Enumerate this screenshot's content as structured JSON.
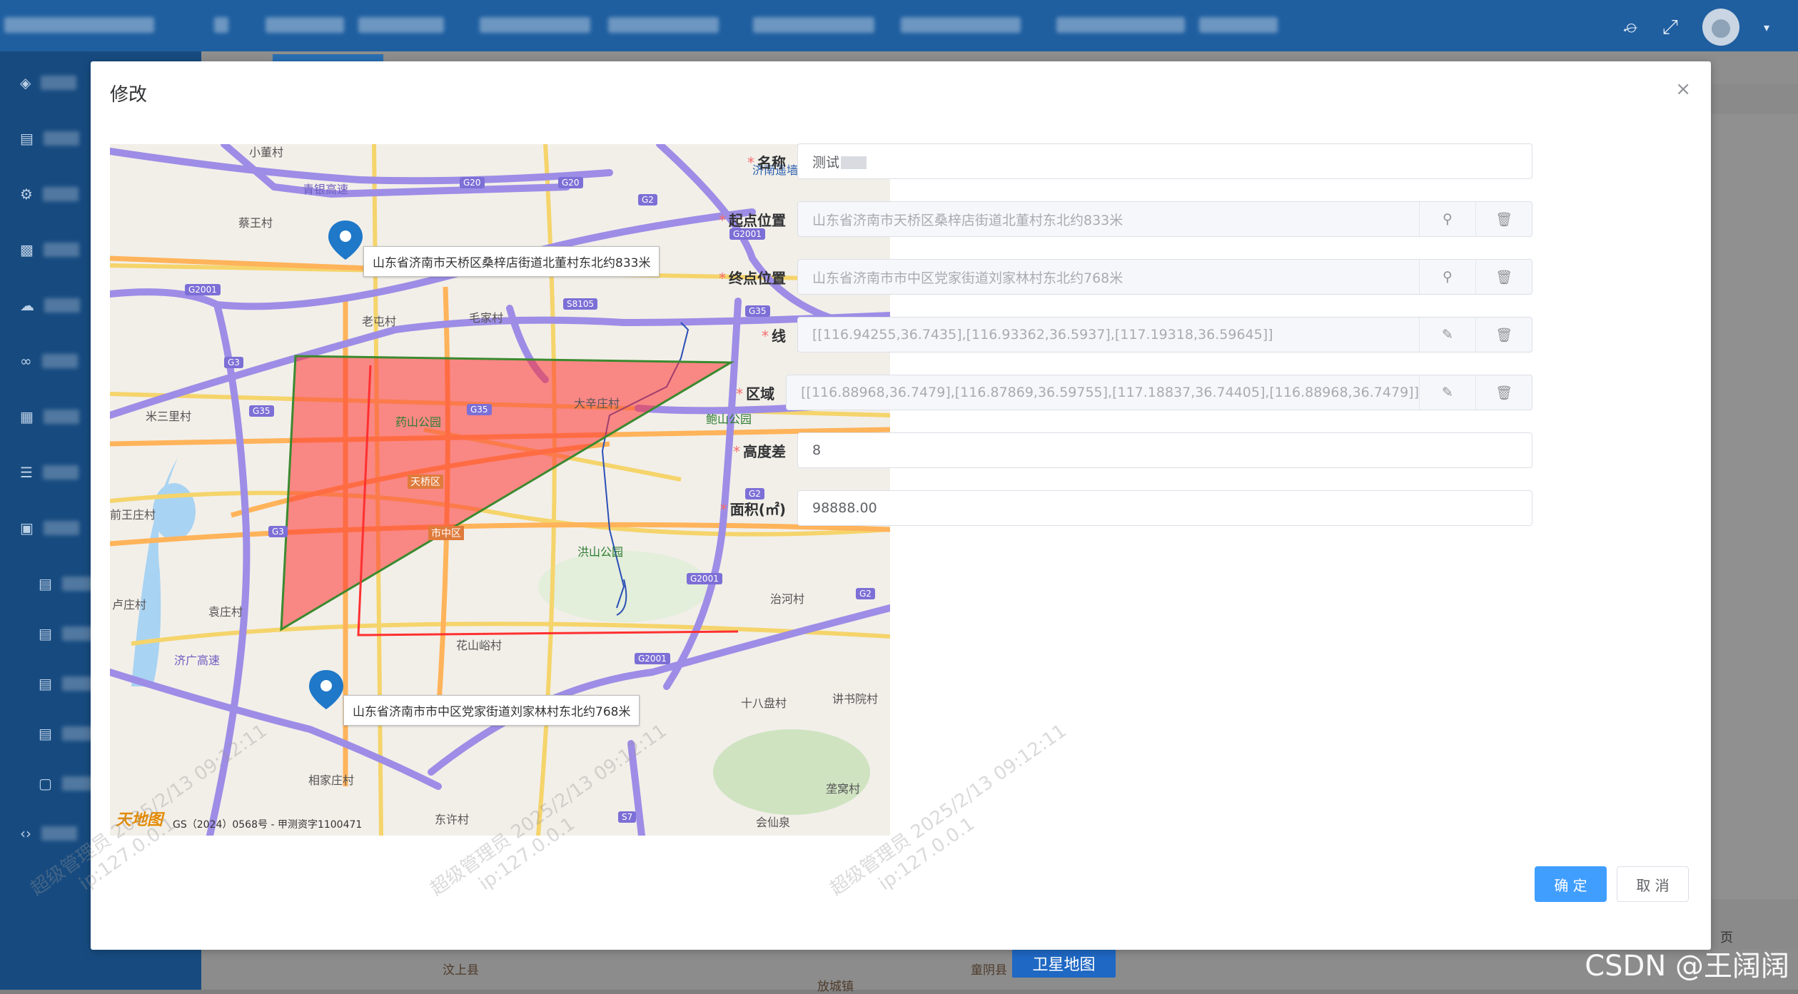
{
  "dialog": {
    "title": "修改",
    "close_icon": "×"
  },
  "map": {
    "start_label": "山东省济南市天桥区桑梓店街道北董村东北约833米",
    "end_label": "山东省济南市市中区党家街道刘家林村东北约768米",
    "logo": "天地图",
    "copyright": "GS（2024）0568号 - 甲测资字1100471",
    "places": {
      "p1": "小董村",
      "p2": "青银高速",
      "p3": "蔡王村",
      "p4": "济南遥墙国际机场",
      "p5": "老屯村",
      "p6": "毛家村",
      "p7": "米三里村",
      "p8": "药山公园",
      "p9": "大辛庄村",
      "p10": "鲍山公园",
      "p11": "天桥区",
      "p12": "市中区",
      "p13": "前王庄村",
      "p14": "洪山公园",
      "p15": "卢庄村",
      "p16": "袁庄村",
      "p17": "治河村",
      "p18": "花山峪村",
      "p19": "济广高速",
      "p20": "十八盘村",
      "p21": "讲书院村",
      "p22": "相家庄村",
      "p23": "垄窝村",
      "p24": "东许村",
      "p25": "会仙泉"
    },
    "roads": {
      "r1": "G20",
      "r2": "G20",
      "r3": "G2",
      "r4": "G2001",
      "r5": "G2001",
      "r6": "S8105",
      "r7": "G35",
      "r8": "G3",
      "r9": "G35",
      "r10": "G35",
      "r11": "G2",
      "r12": "G3",
      "r13": "G2001",
      "r14": "G2",
      "r15": "G2001",
      "r16": "S7"
    }
  },
  "form": {
    "name": {
      "label": "名称",
      "value": "测试"
    },
    "start": {
      "label": "起点位置",
      "value": "山东省济南市天桥区桑梓店街道北董村东北约833米"
    },
    "end": {
      "label": "终点位置",
      "value": "山东省济南市市中区党家街道刘家林村东北约768米"
    },
    "line": {
      "label": "线",
      "value": "[[116.94255,36.7435],[116.93362,36.5937],[117.19318,36.59645]]"
    },
    "area": {
      "label": "区域",
      "value": "[[116.88968,36.7479],[116.87869,36.59755],[117.18837,36.74405],[116.88968,36.7479]]"
    },
    "height": {
      "label": "高度差",
      "value": "8"
    },
    "size": {
      "label": "面积(㎡)",
      "value": "98888.00"
    }
  },
  "buttons": {
    "confirm": "确 定",
    "cancel": "取 消"
  },
  "watermark": {
    "line1": "超级管理员 2025/2/13 09:12:11",
    "line2": "ip:127.0.0.1"
  },
  "background": {
    "satellite_button": "卫星地图",
    "map_place_a": "汶上县",
    "map_place_b": "童阴县",
    "map_place_c": "放城镇",
    "page_suffix": "页",
    "csdn": "CSDN @王阔阔"
  },
  "colors": {
    "primary": "#409eff",
    "required": "#f56c6c",
    "polygon_fill": "#ff4d4d",
    "polygon_stroke": "#2e8b2e",
    "line_stroke": "#ff3030",
    "pin": "#1f78c8"
  }
}
